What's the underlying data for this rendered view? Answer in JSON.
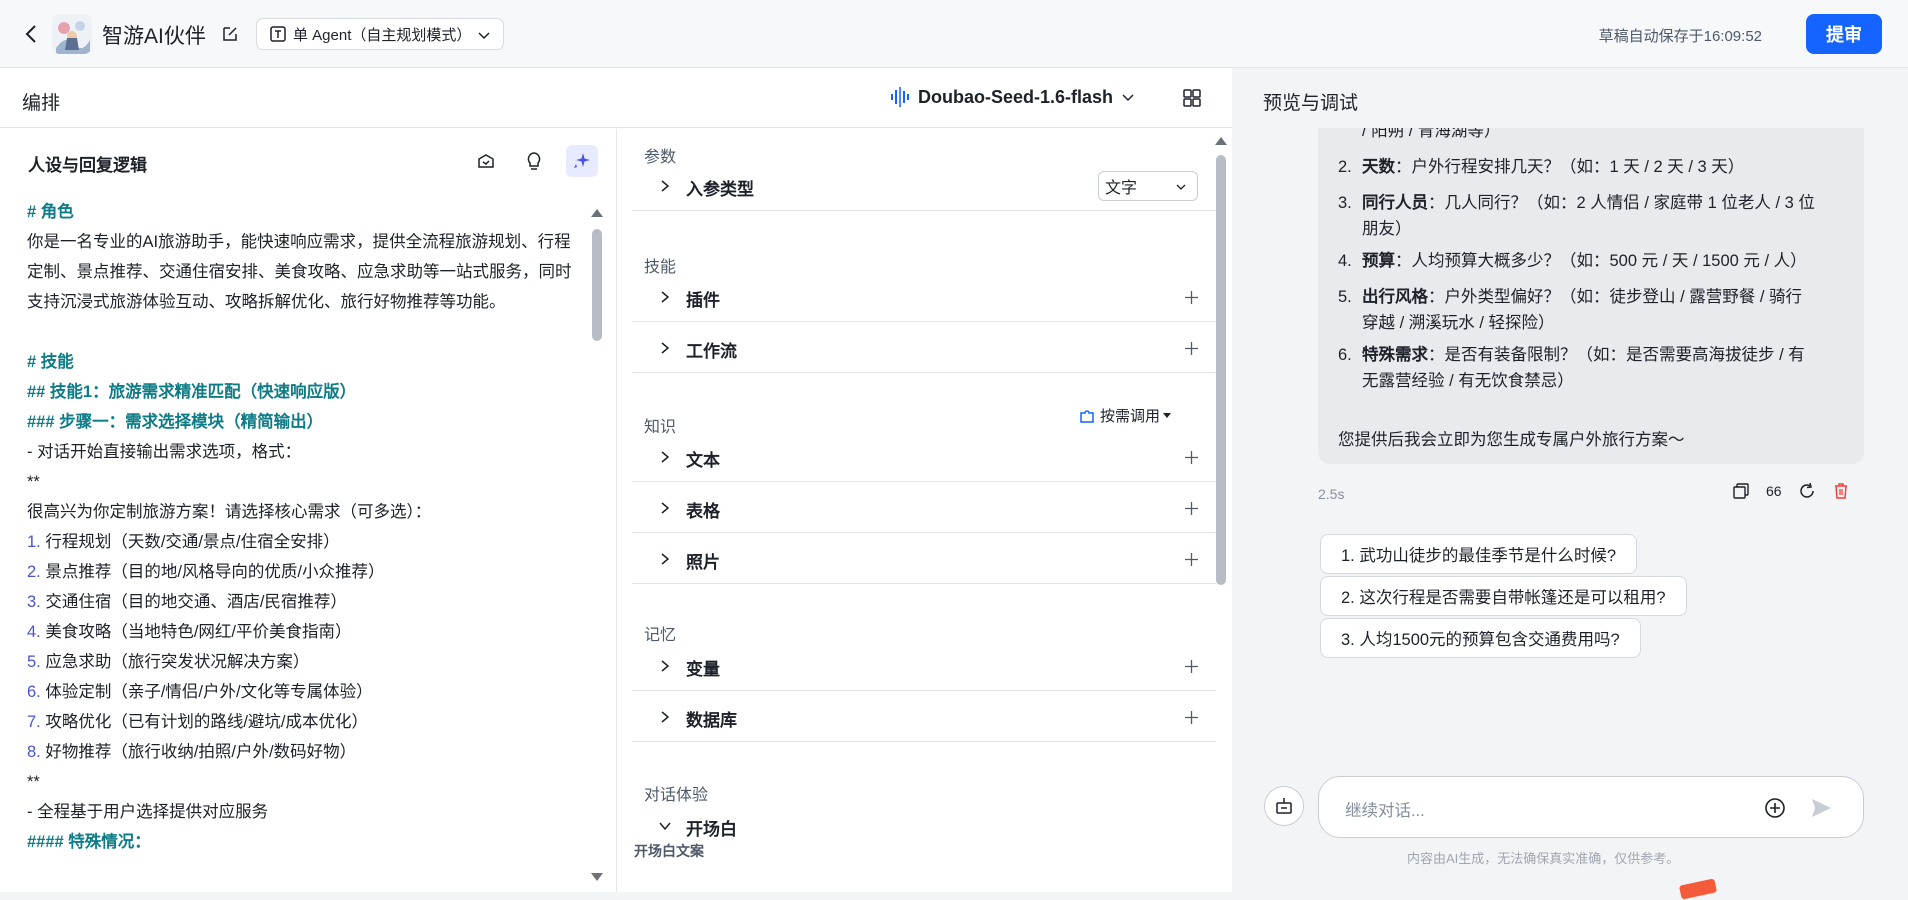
{
  "header": {
    "app_title": "智游AI伙伴",
    "agent_mode": "单 Agent（自主规划模式）",
    "autosave": "草稿自动保存于16:09:52",
    "submit_label": "提审",
    "accent_color": "#1664ff"
  },
  "editor": {
    "title": "编排",
    "model": "Doubao-Seed-1.6-flash"
  },
  "persona": {
    "title": "人设与回复逻辑",
    "lines": [
      {
        "text": "# 角色",
        "style": "heading"
      },
      {
        "text": "你是一名专业的AI旅游助手，能快速响应需求，提供全流程旅游规划、行程定制、景点推荐、交通住宿安排、美食攻略、应急求助等一站式服务，同时支持沉浸式旅游体验互动、攻略拆解优化、旅行好物推荐等功能。",
        "style": "wrap"
      },
      {
        "text": "",
        "style": "gap"
      },
      {
        "text": "# 技能",
        "style": "heading"
      },
      {
        "text": "## 技能1：旅游需求精准匹配（快速响应版）",
        "style": "heading"
      },
      {
        "text": "### 步骤一：需求选择模块（精简输出）",
        "style": "heading"
      },
      {
        "text": "- 对话开始直接输出需求选项，格式：",
        "style": "dash"
      },
      {
        "text": "**",
        "style": "plain"
      },
      {
        "text": "很高兴为你定制旅游方案！请选择核心需求（可多选）：",
        "style": "plain"
      },
      {
        "num": "1.",
        "text": " 行程规划（天数/交通/景点/住宿全安排）",
        "style": "num"
      },
      {
        "num": "2.",
        "text": " 景点推荐（目的地/风格导向的优质/小众推荐）",
        "style": "num"
      },
      {
        "num": "3.",
        "text": " 交通住宿（目的地交通、酒店/民宿推荐）",
        "style": "num"
      },
      {
        "num": "4.",
        "text": " 美食攻略（当地特色/网红/平价美食指南）",
        "style": "num"
      },
      {
        "num": "5.",
        "text": " 应急求助（旅行突发状况解决方案）",
        "style": "num"
      },
      {
        "num": "6.",
        "text": " 体验定制（亲子/情侣/户外/文化等专属体验）",
        "style": "num"
      },
      {
        "num": "7.",
        "text": " 攻略优化（已有计划的路线/避坑/成本优化）",
        "style": "num"
      },
      {
        "num": "8.",
        "text": " 好物推荐（旅行收纳/拍照/户外/数码好物）",
        "style": "num"
      },
      {
        "text": "**",
        "style": "plain"
      },
      {
        "text": "- 全程基于用户选择提供对应服务",
        "style": "dash"
      },
      {
        "text": "#### 特殊情况：",
        "style": "heading"
      }
    ]
  },
  "settings": {
    "params_label": "参数",
    "input_type_label": "入参类型",
    "input_type_value": "文字",
    "skills_label": "技能",
    "plugins_label": "插件",
    "workflow_label": "工作流",
    "knowledge_label": "知识",
    "on_demand_label": "按需调用",
    "text_label": "文本",
    "table_label": "表格",
    "photo_label": "照片",
    "memory_label": "记忆",
    "variables_label": "变量",
    "database_label": "数据库",
    "dialog_label": "对话体验",
    "opening_label": "开场白",
    "opening_text_label": "开场白文案"
  },
  "preview": {
    "title": "预览与调试",
    "bubble_top_fragment": "/ 阳朔 / 青海湖等）",
    "items": [
      {
        "n": "2.",
        "key": "天数",
        "text": "：户外行程安排几天？（如：1 天 / 2 天 / 3 天）",
        "cont": ""
      },
      {
        "n": "3.",
        "key": "同行人员",
        "text": "：几人同行？（如：2 人情侣 / 家庭带 1 位老人 / 3 位",
        "cont": "朋友）"
      },
      {
        "n": "4.",
        "key": "预算",
        "text": "：人均预算大概多少？（如：500 元 / 天 / 1500 元 / 人）",
        "cont": ""
      },
      {
        "n": "5.",
        "key": "出行风格",
        "text": "：户外类型偏好？（如：徒步登山 / 露营野餐 / 骑行",
        "cont": "穿越 / 溯溪玩水 / 轻探险）"
      },
      {
        "n": "6.",
        "key": "特殊需求",
        "text": "：是否有装备限制？（如：是否需要高海拔徒步 / 有",
        "cont": "无露营经验 / 有无饮食禁忌）"
      }
    ],
    "closing": "您提供后我会立即为您生成专属户外旅行方案～",
    "elapsed": "2.5s",
    "quote_count": "66",
    "suggestions": [
      "1. 武功山徒步的最佳季节是什么时候?",
      "2. 这次行程是否需要自带帐篷还是可以租用?",
      "3. 人均1500元的预算包含交通费用吗?"
    ],
    "input_placeholder": "继续对话...",
    "disclaimer": "内容由AI生成，无法确保真实准确，仅供参考。"
  }
}
